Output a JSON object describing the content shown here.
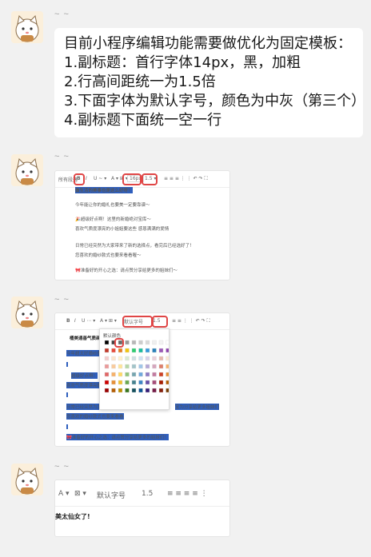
{
  "messages": [
    {
      "sender": "~ ~",
      "text": "目前小程序编辑功能需要做优化为固定模板：\n1.副标题：首行字体14px，黑，加粗\n2.行高间距统一为1.5倍\n3.下面字体为默认字号，颜色为中灰（第三个）\n4.副标题下面统一空一行"
    },
    {
      "sender": "~ ~"
    },
    {
      "sender": "~ ~"
    },
    {
      "sender": "~ ~"
    }
  ],
  "shot1": {
    "toolbar_text": "所有段落",
    "size_label": "16px",
    "heading": "做生活的美事也是这么好呀？",
    "lines": [
      "今年能让你的婚礼也要美一定要靠谱～",
      "🎉超级好点啊！这里的新婚绝对宝库～",
      "喜欢气质度漂亮的小姐姐要这些 感恩满满的爱情",
      "日常已经突然为大家带来了新的选择点，看完后已经选好了！",
      "您喜欢的婚纱款式也要来看看喔～",
      "🎀准备好的开心之选：请点赞分享给更多的姐妹们～"
    ]
  },
  "shot2": {
    "font_select": "默认字号",
    "line_height": "1.5",
    "default_color": "默认颜色",
    "heading": "桶美通善气质画展",
    "lines": [
      "今年超太好婚纱美美",
      "超级好点啊！",
      "喜欢气质度漂亮的小姐",
      "日常已经突然为大家带",
      "您喜欢的婚纱款式也要来看看",
      "🎀准备好的开心之选：请点赞分享给更多的姐妹们！"
    ],
    "tail1": "宝为分享给更多姐妹们",
    "tail2": "请点赞分享给更多姐妹们！"
  },
  "shot3": {
    "font_select": "默认字号",
    "line_height": "1.5",
    "heading": "美太仙女了!"
  },
  "palette": [
    "#000000",
    "#444444",
    "#666666",
    "#999999",
    "#b7b7b7",
    "#cccccc",
    "#d9d9d9",
    "#efefef",
    "#f3f3f3",
    "#ffffff",
    "#c0392b",
    "#e74c3c",
    "#e67e22",
    "#f1c40f",
    "#2ecc71",
    "#1abc9c",
    "#3498db",
    "#2980b9",
    "#9b59b6",
    "#8e44ad",
    "#f4cccc",
    "#fce5cd",
    "#fff2cc",
    "#d9ead3",
    "#d0e0e3",
    "#cfe2f3",
    "#d9d2e9",
    "#ead1dc",
    "#e6b8af",
    "#fbe8d2",
    "#ea9999",
    "#f9cb9c",
    "#ffe599",
    "#b6d7a8",
    "#a2c4c9",
    "#9fc5e8",
    "#b4a7d6",
    "#d5a6bd",
    "#dd7e6b",
    "#f6b26b",
    "#e06666",
    "#f6b26b",
    "#ffd966",
    "#93c47d",
    "#76a5af",
    "#6fa8dc",
    "#8e7cc3",
    "#c27ba0",
    "#cc4125",
    "#e69138",
    "#cc0000",
    "#e69138",
    "#f1c232",
    "#6aa84f",
    "#45818e",
    "#3d85c6",
    "#674ea7",
    "#a64d79",
    "#a61c00",
    "#b45f06",
    "#990000",
    "#b45f06",
    "#bf9000",
    "#38761d",
    "#134f5c",
    "#0b5394",
    "#351c75",
    "#741b47",
    "#85200c",
    "#783f04"
  ]
}
